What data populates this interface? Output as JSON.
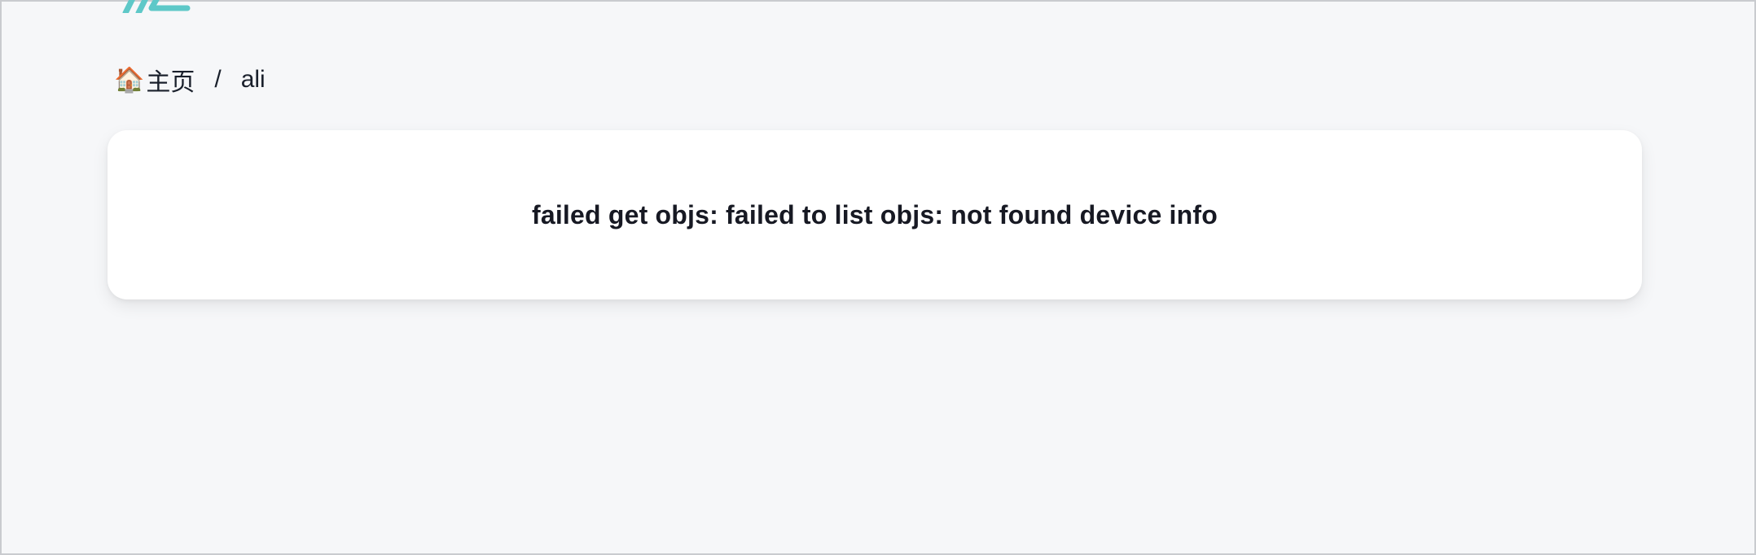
{
  "colors": {
    "background": "#f6f7f9",
    "card": "#ffffff",
    "logo_accent": "#5ec8c8",
    "text": "#1a202c"
  },
  "logo": {
    "icon": "logo-icon"
  },
  "breadcrumb": {
    "items": [
      {
        "icon": "house-emoji",
        "emoji": "🏠",
        "label": "主页"
      },
      {
        "label": "ali"
      }
    ],
    "separator": "/"
  },
  "message": {
    "text": "failed get objs: failed to list objs: not found device info"
  }
}
